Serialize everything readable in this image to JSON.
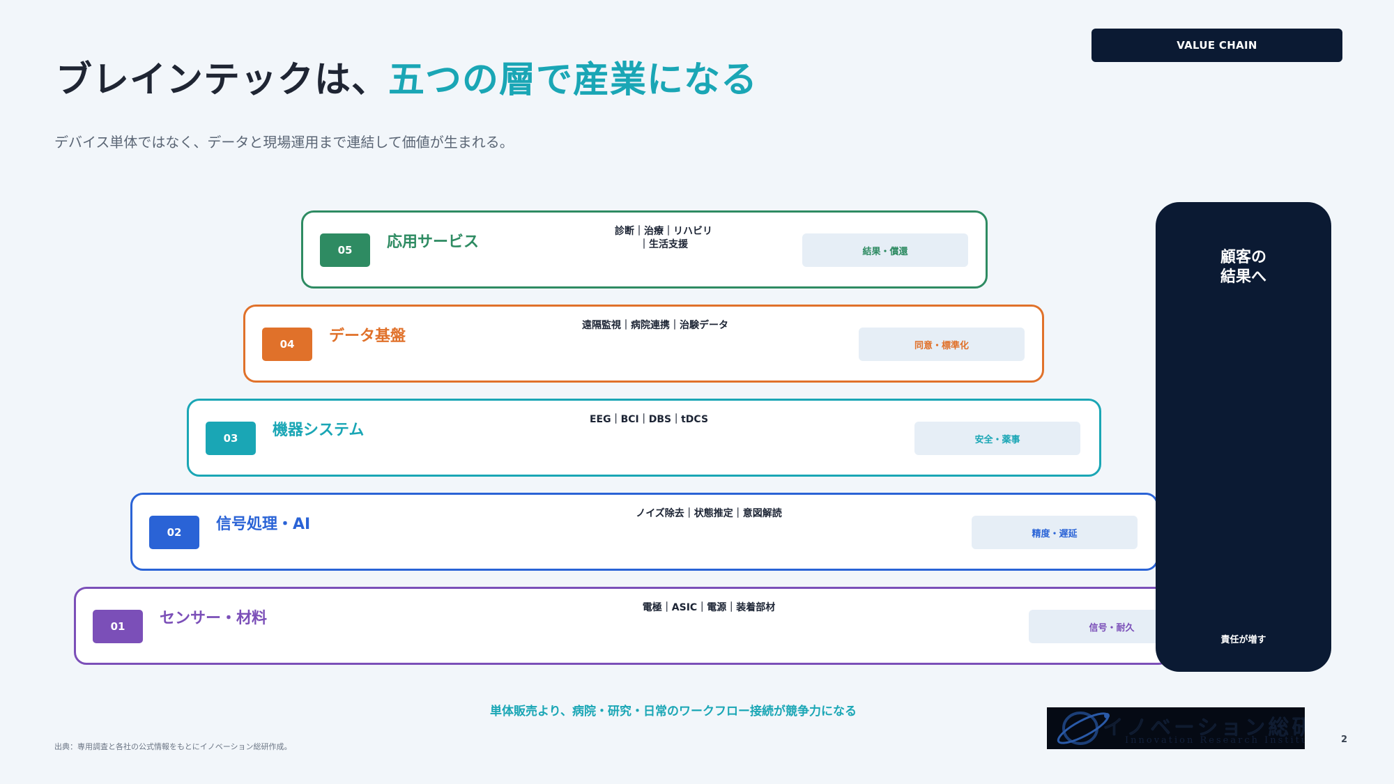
{
  "title": {
    "main": "ブレインテックは、",
    "accent": "五つの層で産業になる"
  },
  "subtitle": "デバイス単体ではなく、データと現場運用まで連結して価値が生まれる。",
  "badge": "VALUE CHAIN",
  "layers": [
    {
      "num": "05",
      "name": "応用サービス",
      "desc": "診断｜治療｜リハビリ｜生活支援",
      "tag": "結果・償還",
      "color": "#2e8b62"
    },
    {
      "num": "04",
      "name": "データ基盤",
      "desc": "遠隔監視｜病院連携｜治験データ",
      "tag": "同意・標準化",
      "color": "#e0712a"
    },
    {
      "num": "03",
      "name": "機器システム",
      "desc": "EEG｜BCI｜DBS｜tDCS",
      "tag": "安全・薬事",
      "color": "#1aa6b5"
    },
    {
      "num": "02",
      "name": "信号処理・AI",
      "desc": "ノイズ除去｜状態推定｜意図解読",
      "tag": "精度・遅延",
      "color": "#2a63d6"
    },
    {
      "num": "01",
      "name": "センサー・材料",
      "desc": "電極｜ASIC｜電源｜装着部材",
      "tag": "信号・耐久",
      "color": "#7b4fb8"
    }
  ],
  "side_panel": {
    "title": "顧客の\n結果へ",
    "footer": "責任が増す"
  },
  "bottom_message": "単体販売より、病院・研究・日常のワークフロー接続が競争力になる",
  "source": "出典：専用調査と各社の公式情報をもとにイノベーション総研作成。",
  "logo": {
    "jp": "イノベーション総研",
    "en": "Innovation Research Institute"
  },
  "page_number": "2"
}
